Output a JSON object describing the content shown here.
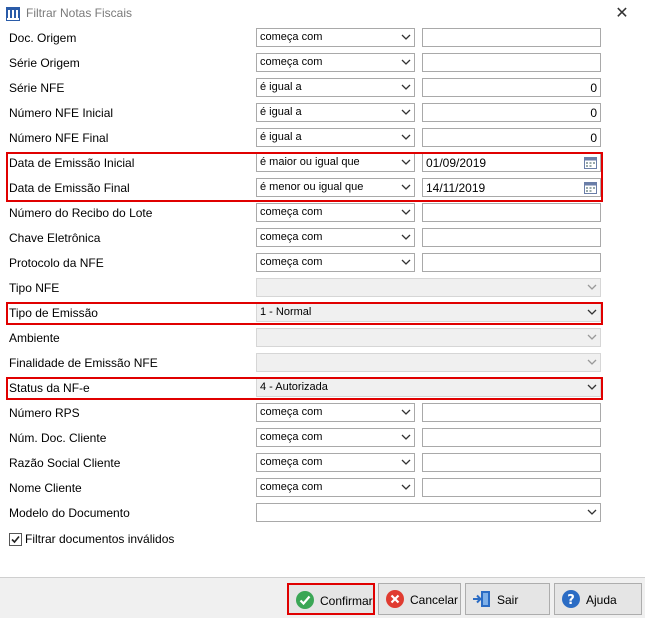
{
  "window": {
    "title": "Filtrar Notas Fiscais",
    "close_label": "✕"
  },
  "rows": [
    {
      "label": "Doc. Origem",
      "operator": "começa com",
      "value": ""
    },
    {
      "label": "Série Origem",
      "operator": "começa com",
      "value": ""
    },
    {
      "label": "Série NFE",
      "operator": "é igual a",
      "value": "0"
    },
    {
      "label": "Número NFE Inicial",
      "operator": "é igual a",
      "value": "0"
    },
    {
      "label": "Número NFE Final",
      "operator": "é igual a",
      "value": "0"
    },
    {
      "label": "Data de Emissão Inicial",
      "operator": "é maior ou igual que",
      "value": "01/09/2019"
    },
    {
      "label": "Data de Emissão Final",
      "operator": "é menor ou igual que",
      "value": "14/11/2019"
    },
    {
      "label": "Número do Recibo do Lote",
      "operator": "começa com",
      "value": ""
    },
    {
      "label": "Chave Eletrônica",
      "operator": "começa com",
      "value": ""
    },
    {
      "label": "Protocolo da NFE",
      "operator": "começa com",
      "value": ""
    },
    {
      "label": "Tipo NFE",
      "operator": "",
      "value": ""
    },
    {
      "label": "Tipo de Emissão",
      "operator": "1 - Normal",
      "value": ""
    },
    {
      "label": "Ambiente",
      "operator": "",
      "value": ""
    },
    {
      "label": "Finalidade de Emissão NFE",
      "operator": "",
      "value": ""
    },
    {
      "label": "Status da NF-e",
      "operator": "4 - Autorizada",
      "value": ""
    },
    {
      "label": "Número RPS",
      "operator": "começa com",
      "value": ""
    },
    {
      "label": "Núm. Doc. Cliente",
      "operator": "começa com",
      "value": ""
    },
    {
      "label": "Razão Social Cliente",
      "operator": "começa com",
      "value": ""
    },
    {
      "label": "Nome Cliente",
      "operator": "começa com",
      "value": ""
    },
    {
      "label": "Modelo do Documento",
      "operator": "",
      "value": ""
    }
  ],
  "checkbox": {
    "label": "Filtrar documentos inválidos",
    "checked": true
  },
  "buttons": {
    "confirm": "Confirmar",
    "cancel": "Cancelar",
    "exit": "Sair",
    "help": "Ajuda"
  },
  "colors": {
    "highlight": "#e00000",
    "confirm_icon": "#3aa655",
    "cancel_icon": "#e03c31",
    "help_icon": "#2b6cc4"
  }
}
